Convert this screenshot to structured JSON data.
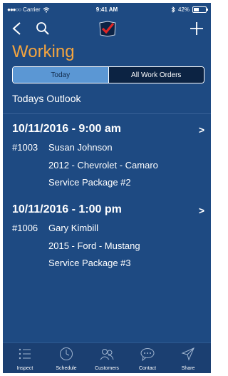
{
  "status": {
    "carrier": "Carrier",
    "time": "9:41 AM",
    "battery_text": "42%",
    "battery_level": 0.42
  },
  "nav": {
    "icons": [
      "back-icon",
      "search-icon",
      "app-logo",
      "plus-icon"
    ]
  },
  "page_title": "Working",
  "segment": {
    "options": [
      "Today",
      "All Work Orders"
    ],
    "selected": "Today"
  },
  "section_title": "Todays Outlook",
  "appointments": [
    {
      "datetime": "10/11/2016 - 9:00 am",
      "order": "#1003",
      "customer": "Susan Johnson",
      "vehicle": "2012 - Chevrolet - Camaro",
      "package": "Service Package #2",
      "chevron": ">"
    },
    {
      "datetime": "10/11/2016 - 1:00 pm",
      "order": "#1006",
      "customer": "Gary Kimbill",
      "vehicle": "2015 - Ford - Mustang",
      "package": "Service Package #3",
      "chevron": ">"
    }
  ],
  "tabs": [
    {
      "label": "Inspect",
      "icon": "list-icon"
    },
    {
      "label": "Schedule",
      "icon": "clock-icon"
    },
    {
      "label": "Customers",
      "icon": "people-icon"
    },
    {
      "label": "Contact",
      "icon": "chat-icon"
    },
    {
      "label": "Share",
      "icon": "send-icon"
    }
  ],
  "colors": {
    "background": "#1e4a82",
    "title": "#f3a43f",
    "segment_active": "#5b97d4",
    "segment_inactive": "#0c2343",
    "tabbar": "#1b3f71"
  }
}
